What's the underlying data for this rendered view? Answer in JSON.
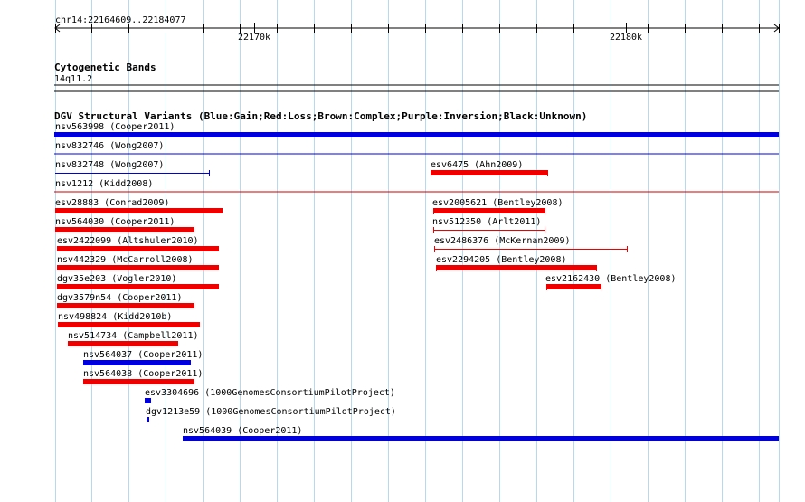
{
  "ruler": {
    "coordinate_label": "chr14:22164609..22184077",
    "tick_labels": [
      "22170k",
      "22180k"
    ]
  },
  "tracks": {
    "cytoband": {
      "title": "Cytogenetic Bands",
      "band_label": "14q11.2"
    },
    "dgv": {
      "title": "DGV Structural Variants (Blue:Gain;Red:Loss;Brown:Complex;Purple:Inversion;Black:Unknown)"
    }
  },
  "colors": {
    "gain": "#0000dd",
    "loss": "#ee0000",
    "gridline": "#b8d8f0",
    "gain_separator": "#0000dd",
    "loss_separator": "#cc0000"
  },
  "variants": [
    {
      "id": "nsv563998",
      "label": "nsv563998 (Cooper2011)",
      "type": "gain",
      "style": "thick"
    },
    {
      "id": "nsv832746",
      "label": "nsv832746 (Wong2007)",
      "type": "gain",
      "style": "thick"
    },
    {
      "id": "nsv832748",
      "label": "nsv832748 (Wong2007)",
      "type": "gain",
      "style": "thin"
    },
    {
      "id": "nsv1212",
      "label": "nsv1212 (Kidd2008)",
      "type": "gain",
      "style": "none"
    },
    {
      "id": "esv6475",
      "label": "esv6475 (Ahn2009)",
      "type": "loss",
      "style": "thick_bracket"
    },
    {
      "id": "esv28883",
      "label": "esv28883 (Conrad2009)",
      "type": "loss",
      "style": "thick"
    },
    {
      "id": "esv2005621",
      "label": "esv2005621 (Bentley2008)",
      "type": "loss",
      "style": "thick_bracket"
    },
    {
      "id": "nsv564030",
      "label": "nsv564030 (Cooper2011)",
      "type": "loss",
      "style": "thick"
    },
    {
      "id": "nsv512350",
      "label": "nsv512350 (Arlt2011)",
      "type": "loss",
      "style": "thin_bracket"
    },
    {
      "id": "esv2422099",
      "label": "esv2422099 (Altshuler2010)",
      "type": "loss",
      "style": "thick"
    },
    {
      "id": "esv2486376",
      "label": "esv2486376 (McKernan2009)",
      "type": "loss",
      "style": "thin_bracket"
    },
    {
      "id": "nsv442329",
      "label": "nsv442329 (McCarroll2008)",
      "type": "loss",
      "style": "thick"
    },
    {
      "id": "esv2294205",
      "label": "esv2294205 (Bentley2008)",
      "type": "loss",
      "style": "thick_bracket"
    },
    {
      "id": "dgv35e203",
      "label": "dgv35e203 (Vogler2010)",
      "type": "loss",
      "style": "thick"
    },
    {
      "id": "esv2162430",
      "label": "esv2162430 (Bentley2008)",
      "type": "loss",
      "style": "thick_bracket"
    },
    {
      "id": "dgv3579n54",
      "label": "dgv3579n54 (Cooper2011)",
      "type": "loss",
      "style": "thick"
    },
    {
      "id": "nsv498824",
      "label": "nsv498824 (Kidd2010b)",
      "type": "loss",
      "style": "thick"
    },
    {
      "id": "nsv514734",
      "label": "nsv514734 (Campbell2011)",
      "type": "loss",
      "style": "thick"
    },
    {
      "id": "nsv564037",
      "label": "nsv564037 (Cooper2011)",
      "type": "gain",
      "style": "thick"
    },
    {
      "id": "nsv564038",
      "label": "nsv564038 (Cooper2011)",
      "type": "loss",
      "style": "thick"
    },
    {
      "id": "esv3304696",
      "label": "esv3304696 (1000GenomesConsortiumPilotProject)",
      "type": "gain",
      "style": "thick"
    },
    {
      "id": "dgv1213e59",
      "label": "dgv1213e59 (1000GenomesConsortiumPilotProject)",
      "type": "gain",
      "style": "thick"
    },
    {
      "id": "nsv564039",
      "label": "nsv564039 (Cooper2011)",
      "type": "gain",
      "style": "thick"
    }
  ]
}
